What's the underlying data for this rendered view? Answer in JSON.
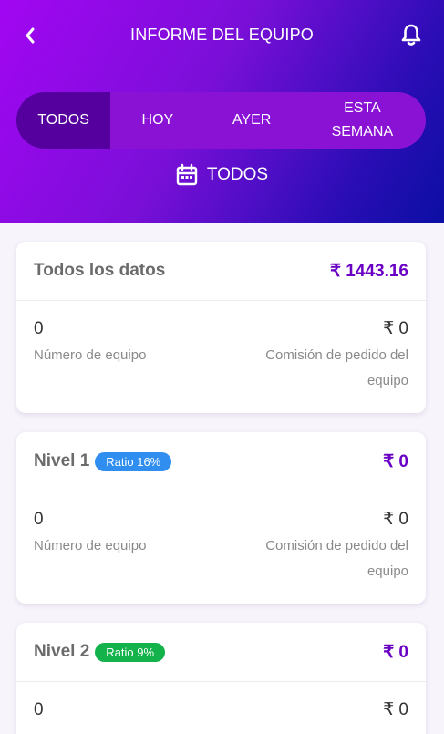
{
  "header": {
    "title": "INFORME DEL EQUIPO",
    "back_icon": "chevron-left-icon",
    "bell_icon": "bell-icon"
  },
  "tabs": [
    {
      "label": "TODOS",
      "active": true
    },
    {
      "label": "HOY",
      "active": false
    },
    {
      "label": "AYER",
      "active": false
    },
    {
      "label": "ESTA SEMANA",
      "active": false
    }
  ],
  "date_range": {
    "icon": "calendar-icon",
    "label": "TODOS"
  },
  "cards": [
    {
      "title": "Todos los datos",
      "badge": null,
      "amount": "₹ 1443.16",
      "team_count": "0",
      "team_count_label": "Número de equipo",
      "commission": "₹ 0",
      "commission_label": "Comisión de pedido del equipo"
    },
    {
      "title": "Nivel 1",
      "badge": "Ratio 16%",
      "badge_color": "#2f8ef0",
      "amount": "₹ 0",
      "team_count": "0",
      "team_count_label": "Número de equipo",
      "commission": "₹ 0",
      "commission_label": "Comisión de pedido del equipo"
    },
    {
      "title": "Nivel 2",
      "badge": "Ratio 9%",
      "badge_color": "#13b24a",
      "amount": "₹ 0",
      "team_count": "0",
      "commission": "₹ 0"
    }
  ],
  "colors": {
    "accent": "#6a00c4",
    "header_start": "#a206f2",
    "header_end": "#0b0ea3",
    "active_tab": "#55009e"
  }
}
